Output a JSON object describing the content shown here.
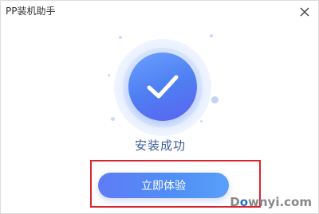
{
  "window": {
    "title": "PP装机助手",
    "close_icon": "close-icon"
  },
  "main": {
    "status_icon": "checkmark-icon",
    "status_text": "安装成功",
    "primary_button_label": "立即体验"
  },
  "watermark": {
    "prefix": "D",
    "accent": "o",
    "suffix": "wnyi.com"
  },
  "colors": {
    "accent": "#4f7ff2",
    "button": "#5a86f6",
    "highlight": "#d8262f",
    "status_text": "#3f5d9a"
  }
}
